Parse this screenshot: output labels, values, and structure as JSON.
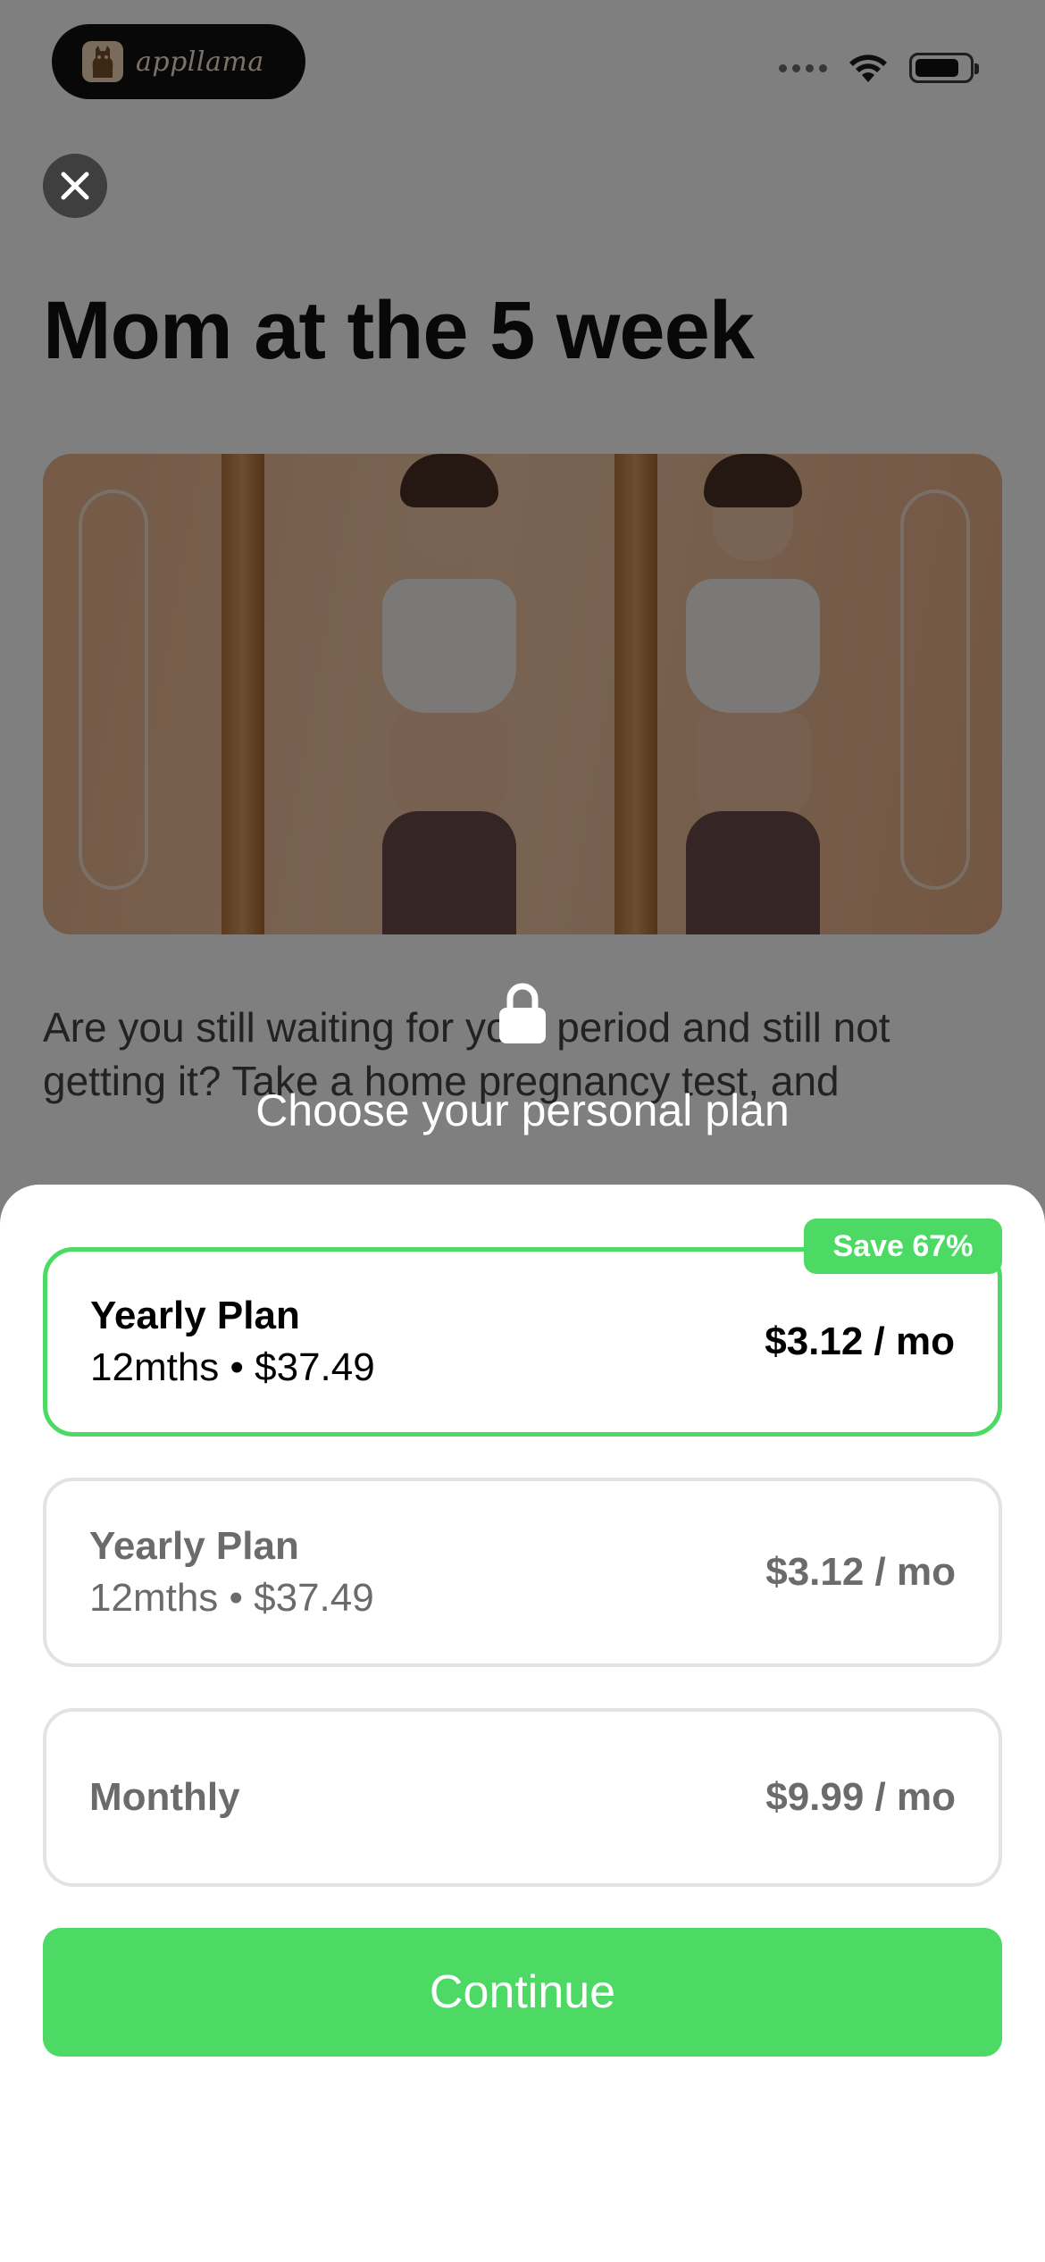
{
  "status_bar": {
    "app_badge_text": "appllama",
    "icons": [
      "llama-icon",
      "signal-dots-icon",
      "wifi-icon",
      "battery-icon"
    ]
  },
  "article": {
    "title": "Mom at the 5 week",
    "body": "Are you still waiting for your period and still not getting it? Take a home pregnancy test, and"
  },
  "paywall": {
    "lock_icon": "lock-icon",
    "heading": "Choose your personal plan",
    "plans": [
      {
        "name": "Yearly Plan",
        "detail": "12mths • $37.49",
        "price": "$3.12 / mo",
        "badge": "Save 67%",
        "selected": true
      },
      {
        "name": "Yearly Plan",
        "detail": "12mths • $37.49",
        "price": "$3.12 / mo",
        "selected": false
      },
      {
        "name": "Monthly",
        "price": "$9.99 / mo",
        "selected": false
      }
    ],
    "continue_label": "Continue"
  },
  "colors": {
    "accent_green": "#4cd964",
    "overlay": "rgba(0,0,0,0.50)",
    "idle_border": "#e3e3e3"
  }
}
